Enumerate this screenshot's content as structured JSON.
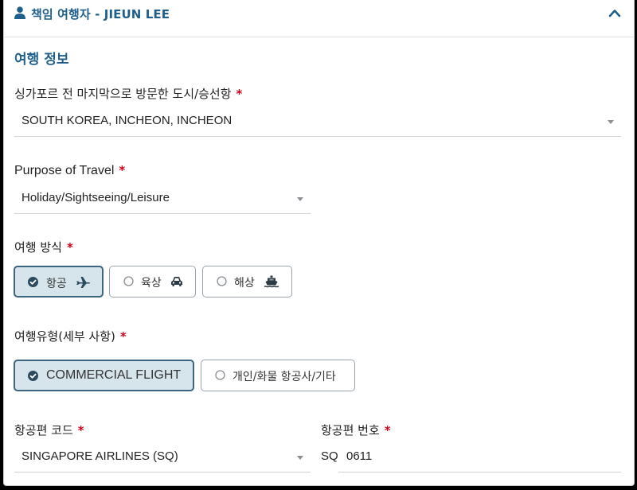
{
  "header": {
    "title": "책임 여행자 - JIEUN LEE"
  },
  "section": {
    "title": "여행 정보"
  },
  "last_city": {
    "label": "싱가포르 전 마지막으로 방문한 도시/승선항",
    "required": "*",
    "value": "SOUTH KOREA, INCHEON, INCHEON"
  },
  "purpose": {
    "label": "Purpose of Travel",
    "required": "*",
    "value": "Holiday/Sightseeing/Leisure"
  },
  "travel_mode": {
    "label": "여행 방식",
    "required": "*",
    "options": [
      {
        "label": "항공",
        "icon": "plane-icon",
        "selected": true
      },
      {
        "label": "육상",
        "icon": "car-icon",
        "selected": false
      },
      {
        "label": "해상",
        "icon": "ship-icon",
        "selected": false
      }
    ]
  },
  "travel_type": {
    "label": "여행유형(세부 사항)",
    "required": "*",
    "options": [
      {
        "label": "COMMERCIAL FLIGHT",
        "selected": true
      },
      {
        "label": "개인/화물 항공사/기타",
        "selected": false
      }
    ]
  },
  "flight_code": {
    "label": "항공편 코드",
    "required": "*",
    "value": "SINGAPORE AIRLINES (SQ)"
  },
  "flight_number": {
    "label": "항공편 번호",
    "required": "*",
    "prefix": "SQ",
    "value": "0611"
  },
  "colors": {
    "accent": "#1f5f8b",
    "required": "#d0021b",
    "chip_active_bg": "#d6e4ec",
    "chip_active_border": "#3b6580"
  }
}
